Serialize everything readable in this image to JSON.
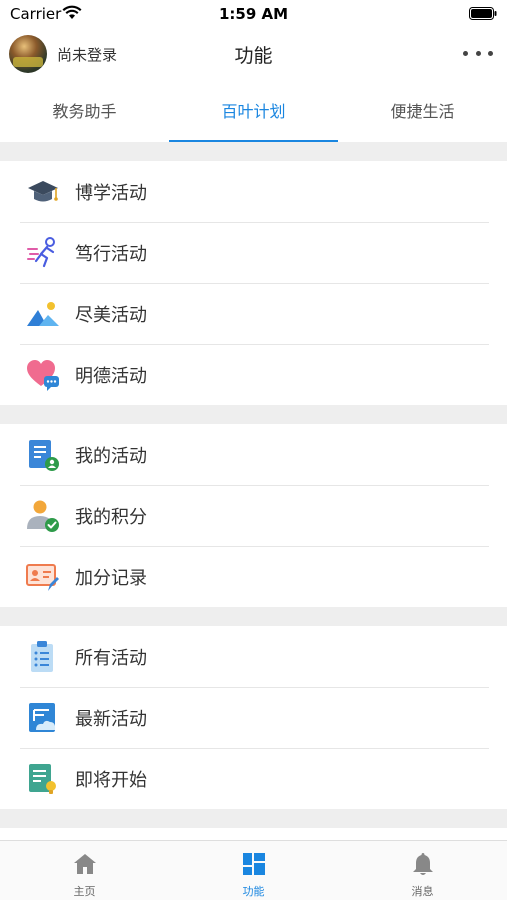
{
  "status_bar": {
    "carrier": "Carrier",
    "time": "1:59 AM"
  },
  "nav": {
    "login_text": "尚未登录",
    "title": "功能"
  },
  "tabs": [
    {
      "label": "教务助手",
      "active": false
    },
    {
      "label": "百叶计划",
      "active": true
    },
    {
      "label": "便捷生活",
      "active": false
    }
  ],
  "sections": [
    {
      "items": [
        {
          "label": "博学活动",
          "icon": "graduation-cap-icon"
        },
        {
          "label": "笃行活动",
          "icon": "running-person-icon"
        },
        {
          "label": "尽美活动",
          "icon": "landscape-icon"
        },
        {
          "label": "明德活动",
          "icon": "heart-chat-icon"
        }
      ]
    },
    {
      "items": [
        {
          "label": "我的活动",
          "icon": "document-user-icon"
        },
        {
          "label": "我的积分",
          "icon": "user-check-icon"
        },
        {
          "label": "加分记录",
          "icon": "id-card-edit-icon"
        }
      ]
    },
    {
      "items": [
        {
          "label": "所有活动",
          "icon": "clipboard-list-icon"
        },
        {
          "label": "最新活动",
          "icon": "document-cloud-icon"
        },
        {
          "label": "即将开始",
          "icon": "document-bulb-icon"
        }
      ]
    }
  ],
  "tab_bar": [
    {
      "label": "主页",
      "icon": "home-icon",
      "active": false
    },
    {
      "label": "功能",
      "icon": "grid-icon",
      "active": true
    },
    {
      "label": "消息",
      "icon": "bell-icon",
      "active": false
    }
  ],
  "colors": {
    "accent": "#1a86e0",
    "section_gap": "#eeeeee"
  }
}
